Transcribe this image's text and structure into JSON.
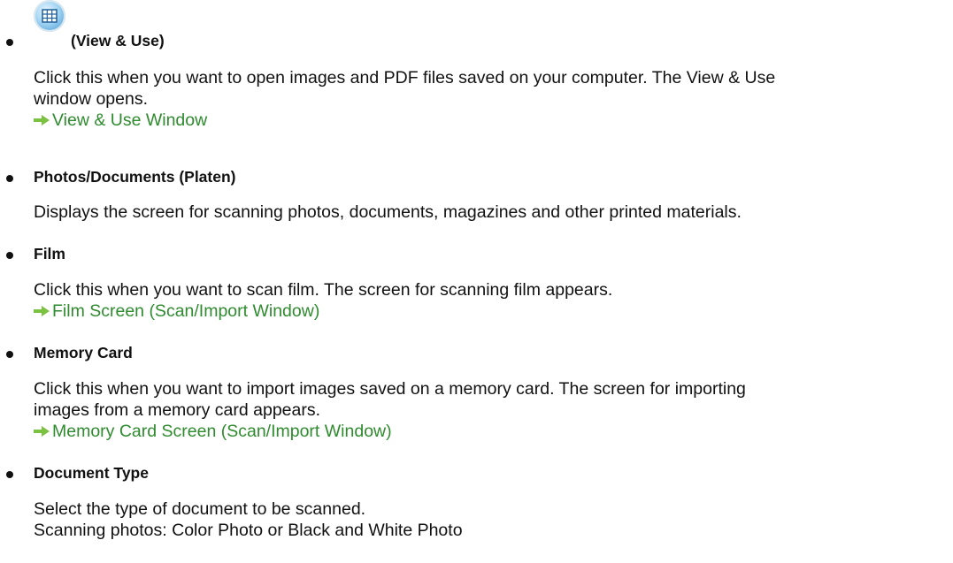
{
  "items": [
    {
      "heading": "(View & Use)",
      "icon": "view-use-icon",
      "lines": [
        "Click this when you want to open images and PDF files saved on your computer. The View & Use",
        "window opens."
      ],
      "link": "View & Use Window"
    },
    {
      "heading": "Photos/Documents (Platen)",
      "lines": [
        "Displays the screen for scanning photos, documents, magazines and other printed materials."
      ]
    },
    {
      "heading": "Film",
      "lines": [
        "Click this when you want to scan film. The screen for scanning film appears."
      ],
      "link": "Film Screen (Scan/Import Window)"
    },
    {
      "heading": "Memory Card",
      "lines": [
        "Click this when you want to import images saved on a memory card. The screen for importing",
        "images from a memory card appears."
      ],
      "link": "Memory Card Screen (Scan/Import Window)"
    },
    {
      "heading": "Document Type",
      "lines": [
        "Select the type of document to be scanned.",
        "Scanning photos: Color Photo or Black and White Photo"
      ]
    }
  ],
  "colors": {
    "link": "#2e8b2e",
    "arrow": "#7cc242",
    "text": "#111111"
  }
}
